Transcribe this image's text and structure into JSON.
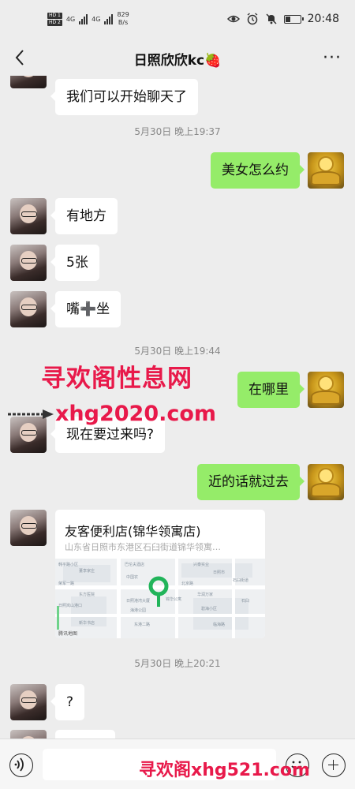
{
  "status_bar": {
    "sim_labels": [
      "HD 1",
      "HD 2"
    ],
    "net_type_1": "4G",
    "net_type_2": "4G",
    "net_speed_value": "829",
    "net_speed_unit": "B/s",
    "time": "20:48",
    "icons": [
      "eye-icon",
      "alarm-icon",
      "mute-icon",
      "battery-icon"
    ]
  },
  "header": {
    "title": "日照欣欣kc🍓",
    "back_icon": "chevron-left-icon",
    "more_label": "···"
  },
  "messages": [
    {
      "side": "left",
      "type": "text",
      "text": "我们可以开始聊天了"
    },
    {
      "type": "time",
      "text": "5月30日 晚上19:37"
    },
    {
      "side": "right",
      "type": "text",
      "text": "美女怎么约"
    },
    {
      "side": "left",
      "type": "text",
      "text": "有地方"
    },
    {
      "side": "left",
      "type": "text",
      "text": "5张"
    },
    {
      "side": "left",
      "type": "text",
      "text": "嘴➕坐"
    },
    {
      "type": "time",
      "text": "5月30日 晚上19:44"
    },
    {
      "side": "right",
      "type": "text",
      "text": "在哪里"
    },
    {
      "side": "left",
      "type": "text",
      "text": "现在要过来吗?"
    },
    {
      "side": "right",
      "type": "text",
      "text": "近的话就过去"
    },
    {
      "side": "left",
      "type": "location",
      "name": "友客便利店(锦华领寓店)",
      "address": "山东省日照市东港区石臼街道锦华领寓…",
      "map_provider": "腾讯地图"
    },
    {
      "type": "time",
      "text": "5月30日 晚上20:21"
    },
    {
      "side": "left",
      "type": "text",
      "text": "?"
    }
  ],
  "map_labels": [
    "韩平路小区",
    "董李家庄",
    "巴伦夫酒店",
    "荣军一路",
    "北京路",
    "东方医院",
    "兴泰实业",
    "中国农",
    "日照市",
    "石臼街道",
    "日照岚山港口",
    "日照港湾大厦",
    "华润万家",
    "石臼",
    "海港公园",
    "碧海小区",
    "锦华公寓",
    "东港二路",
    "新华书店",
    "临海路"
  ],
  "watermarks": {
    "top": "寻欢阁性息网",
    "mid": "xhg2020.com",
    "bottom": "寻欢阁xhg521.com"
  },
  "colors": {
    "background": "#ededed",
    "bubble_self": "#95ec69",
    "bubble_other": "#ffffff",
    "map_pin": "#21b45a",
    "watermark": "#e8194a"
  }
}
